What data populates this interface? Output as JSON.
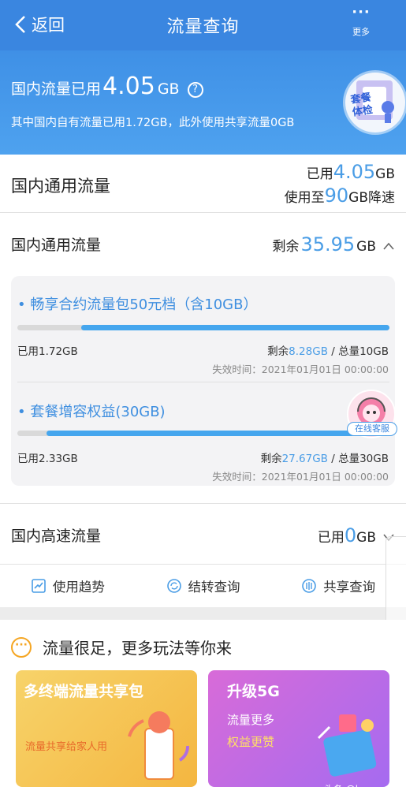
{
  "header": {
    "back_label": "返回",
    "title": "流量查询",
    "more_label": "更多"
  },
  "banner": {
    "usage_prefix": "国内流量已用",
    "usage_value": "4.05",
    "usage_unit": "GB",
    "help_symbol": "?",
    "detail": "其中国内自有流量已用1.72GB，此外使用共享流量0GB",
    "badge_text_1": "套餐",
    "badge_text_2": "体检"
  },
  "general": {
    "title": "国内通用流量",
    "used_prefix": "已用",
    "used_value": "4.05",
    "used_unit": "GB",
    "throttle_prefix": "使用至",
    "throttle_value": "90",
    "throttle_suffix": "GB降速"
  },
  "general_detail": {
    "title": "国内通用流量",
    "remaining_prefix": "剩余",
    "remaining_value": "35.95",
    "remaining_unit": "GB",
    "packages": [
      {
        "name": "• 畅享合约流量包50元档（含10GB）",
        "used_fraction": 0.172,
        "used_text": "已用1.72GB",
        "remaining_prefix": "剩余",
        "remaining_value": "8.28GB",
        "total_text": " / 总量10GB",
        "expire": "失效时间：2021年01月01日 00:00:00"
      },
      {
        "name": "• 套餐增容权益(30GB)",
        "used_fraction": 0.078,
        "used_text": "已用2.33GB",
        "remaining_prefix": "剩余",
        "remaining_value": "27.67GB",
        "total_text": " / 总量30GB",
        "expire": "失效时间：2021年01月01日 00:00:00"
      }
    ],
    "service_label": "在线客服"
  },
  "highspeed": {
    "title": "国内高速流量",
    "used_prefix": "已用",
    "used_value": "0",
    "used_unit": "GB"
  },
  "actions": [
    {
      "label": "使用趋势",
      "icon": "trend-icon"
    },
    {
      "label": "结转查询",
      "icon": "refresh-icon"
    },
    {
      "label": "共享查询",
      "icon": "share-icon"
    }
  ],
  "promo": {
    "heading": "流量很足，更多玩法等你来",
    "card_a_title": "多终端流量共享包",
    "card_a_text": "流量共享给家人用",
    "card_b_title": "升级5G",
    "card_b_line1": "流量更多",
    "card_b_line2": "权益更赞"
  },
  "watermark": "头条 @bangyou",
  "colors": {
    "primary": "#3a86e0",
    "accent_blue": "#4a9de6",
    "bar_fill": "#45a6ee"
  }
}
